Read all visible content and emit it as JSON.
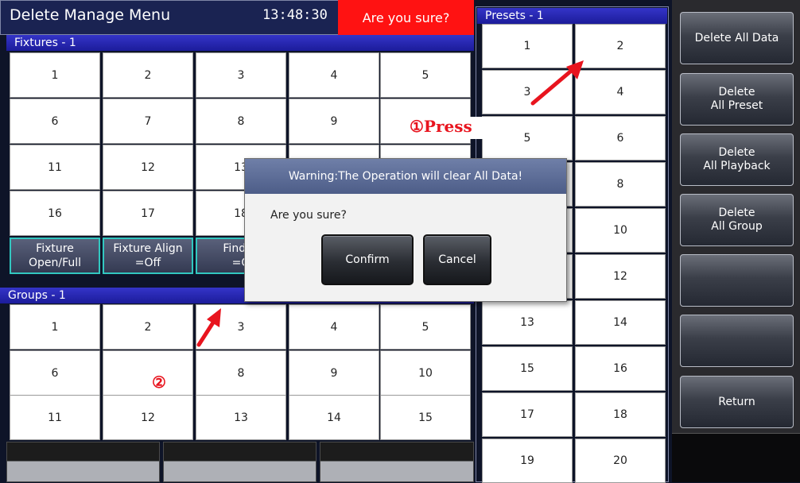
{
  "header": {
    "title": "Delete Manage Menu",
    "time": "13:48:30",
    "alert": "Are you sure?"
  },
  "fixtures": {
    "header": "Fixtures - 1",
    "cells": [
      "1",
      "2",
      "3",
      "4",
      "5",
      "6",
      "7",
      "8",
      "9",
      "",
      "11",
      "12",
      "13",
      "",
      "",
      "16",
      "17",
      "18",
      "",
      ""
    ],
    "buttons": [
      "Fixture\nOpen/Full",
      "Fixture Align\n=Off",
      "Find M\n=O"
    ]
  },
  "groups": {
    "header": "Groups - 1",
    "cells": [
      "1",
      "2",
      "3",
      "4",
      "5",
      "6",
      "",
      "8",
      "9",
      "10",
      "11",
      "12",
      "13",
      "14",
      "15"
    ]
  },
  "presets": {
    "header": "Presets - 1",
    "cells": [
      "1",
      "2",
      "3",
      "4",
      "5",
      "6",
      "",
      "8",
      "",
      "10",
      "",
      "12",
      "13",
      "14",
      "15",
      "16",
      "17",
      "18",
      "19",
      "20"
    ]
  },
  "side_buttons": [
    "Delete All Data",
    "Delete\nAll Preset",
    "Delete\nAll Playback",
    "Delete\nAll Group",
    "",
    "",
    "Return"
  ],
  "dialog": {
    "title": "Warning:The Operation will clear All Data!",
    "message": "Are you sure?",
    "confirm": "Confirm",
    "cancel": "Cancel"
  },
  "annotations": {
    "step1": "①Press",
    "step2": "②"
  },
  "colors": {
    "alert": "#ff1212",
    "header_blue": "#2a2ab0",
    "arrow": "#e8141e",
    "teal_border": "#32c7c0"
  }
}
